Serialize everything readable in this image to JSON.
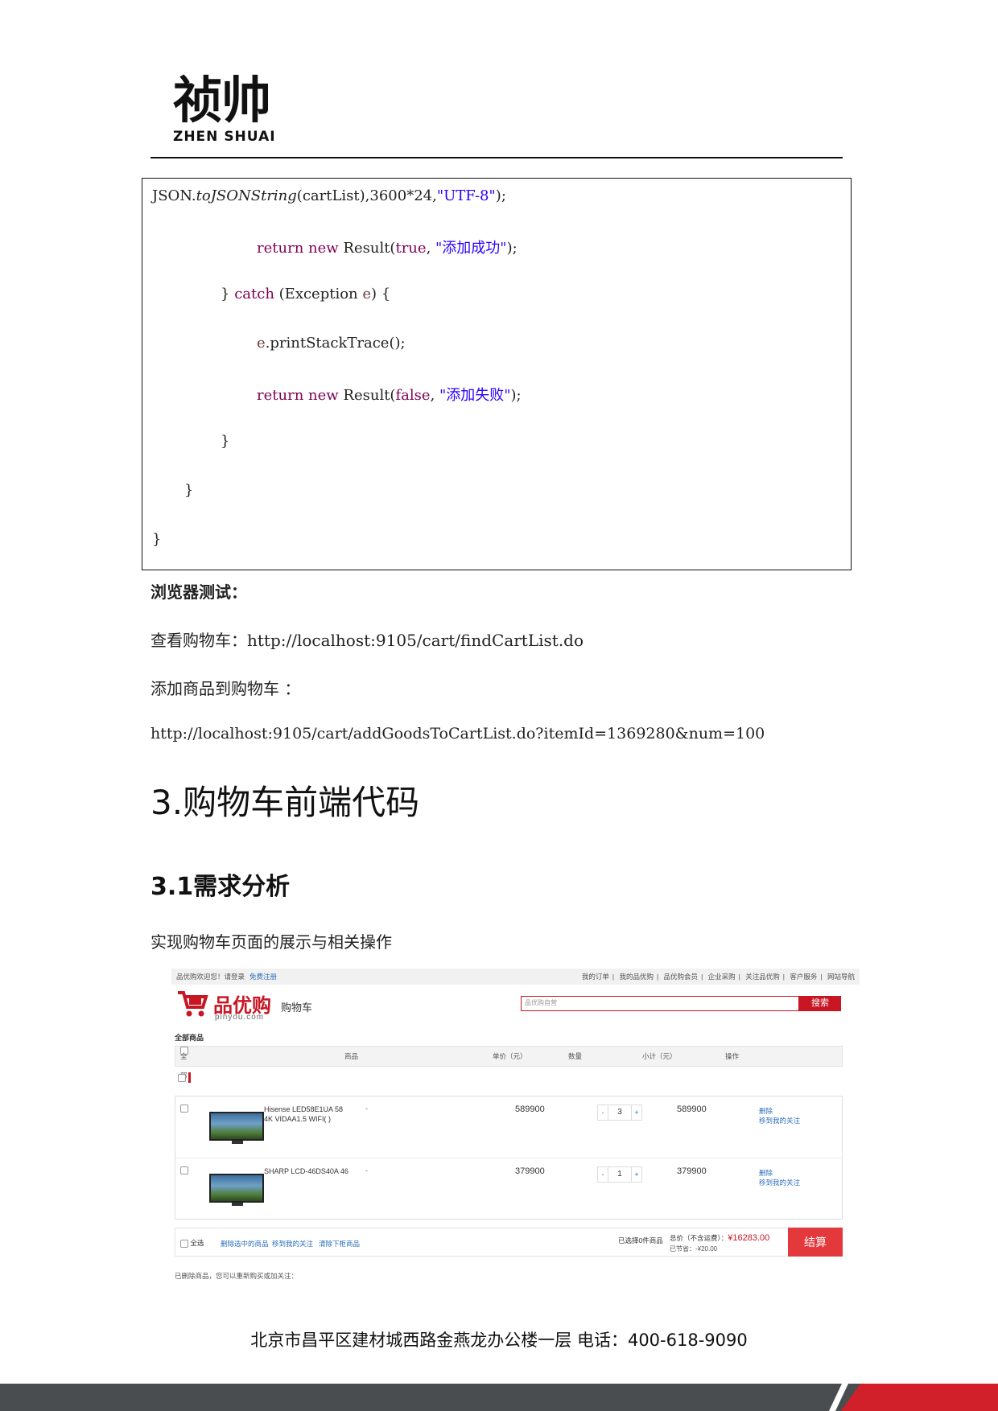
{
  "logo": {
    "chinese": "祯帅",
    "english": "ZHEN SHUAI"
  },
  "code": {
    "line1": {
      "a": "JSON.",
      "b": "toJSONString",
      "c": "(cartList),3600*24,",
      "d": "\"UTF-8\"",
      "e": ");"
    },
    "line2": {
      "kw1": "return",
      "kw2": "new",
      "t": "Result(",
      "kw3": "true",
      "s": "\"添加成功\"",
      "e": ");"
    },
    "line3": {
      "a": "}",
      "kw": "catch",
      "b": "(Exception",
      "v": "e",
      "c": ") {"
    },
    "line4": {
      "v": "e",
      "b": ".printStackTrace();"
    },
    "line5": {
      "kw1": "return",
      "kw2": "new",
      "t": "Result(",
      "kw3": "false",
      "s": "\"添加失败\"",
      "e": ");"
    },
    "line6": "}",
    "line7": "}",
    "line8": "}"
  },
  "text": {
    "browser_test": "浏览器测试：",
    "view_cart": "查看购物车：http://localhost:9105/cart/findCartList.do",
    "add_goods": "添加商品到购物车 ：",
    "add_goods_url": "http://localhost:9105/cart/addGoodsToCartList.do?itemId=1369280&num=100",
    "heading1": "3.购物车前端代码",
    "heading2": "3.1需求分析",
    "intro": "实现购物车页面的展示与相关操作"
  },
  "cart_shot": {
    "topbar": {
      "welcome": "品优购欢迎您！请登录",
      "register": "免费注册",
      "links": [
        "我的订单",
        "|",
        "我的品优购",
        "|",
        "品优购会员",
        "|",
        "企业采购",
        "|",
        "关注品优购",
        "|",
        "客户服务",
        "|",
        "网站导航"
      ]
    },
    "brand": {
      "cn": "品优购",
      "en": "pinyou.com"
    },
    "page_title": "购物车",
    "search_placeholder": "品优购自营",
    "search_button": "搜索",
    "all_goods": "全部商品",
    "headers": {
      "all": "全部",
      "goods": "商品",
      "unit_price": "单价（元）",
      "quantity": "数量",
      "subtotal": "小计（元）",
      "ops": "操作"
    },
    "items": [
      {
        "name": "Hisense LED58E1UA 58 4K VIDAA1.5 WIFI( )",
        "spec": "-",
        "price": "589900",
        "qty": "3",
        "subtotal": "589900",
        "op_delete": "删除",
        "op_follow": "移到我的关注"
      },
      {
        "name": "SHARP LCD-46DS40A 46",
        "spec": "-",
        "price": "379900",
        "qty": "1",
        "subtotal": "379900",
        "op_delete": "删除",
        "op_follow": "移到我的关注"
      }
    ],
    "qty_minus": "-",
    "qty_plus": "+",
    "footer": {
      "select_all": "全选",
      "delete_selected": "删除选中的商品",
      "move_follow": "移到我的关注",
      "clear_removed": "清除下柜商品",
      "chosen": "已选择0件商品",
      "total_label": "总价（不含运费）：",
      "total_amount": "¥16283.00",
      "saved": "已节省：-¥20.00",
      "checkout": "结算"
    },
    "deleted_note": "已删除商品，您可以重新购买或加关注："
  },
  "footer": {
    "address": "北京市昌平区建材城西路金燕龙办公楼一层   电话：400-618-9090"
  }
}
